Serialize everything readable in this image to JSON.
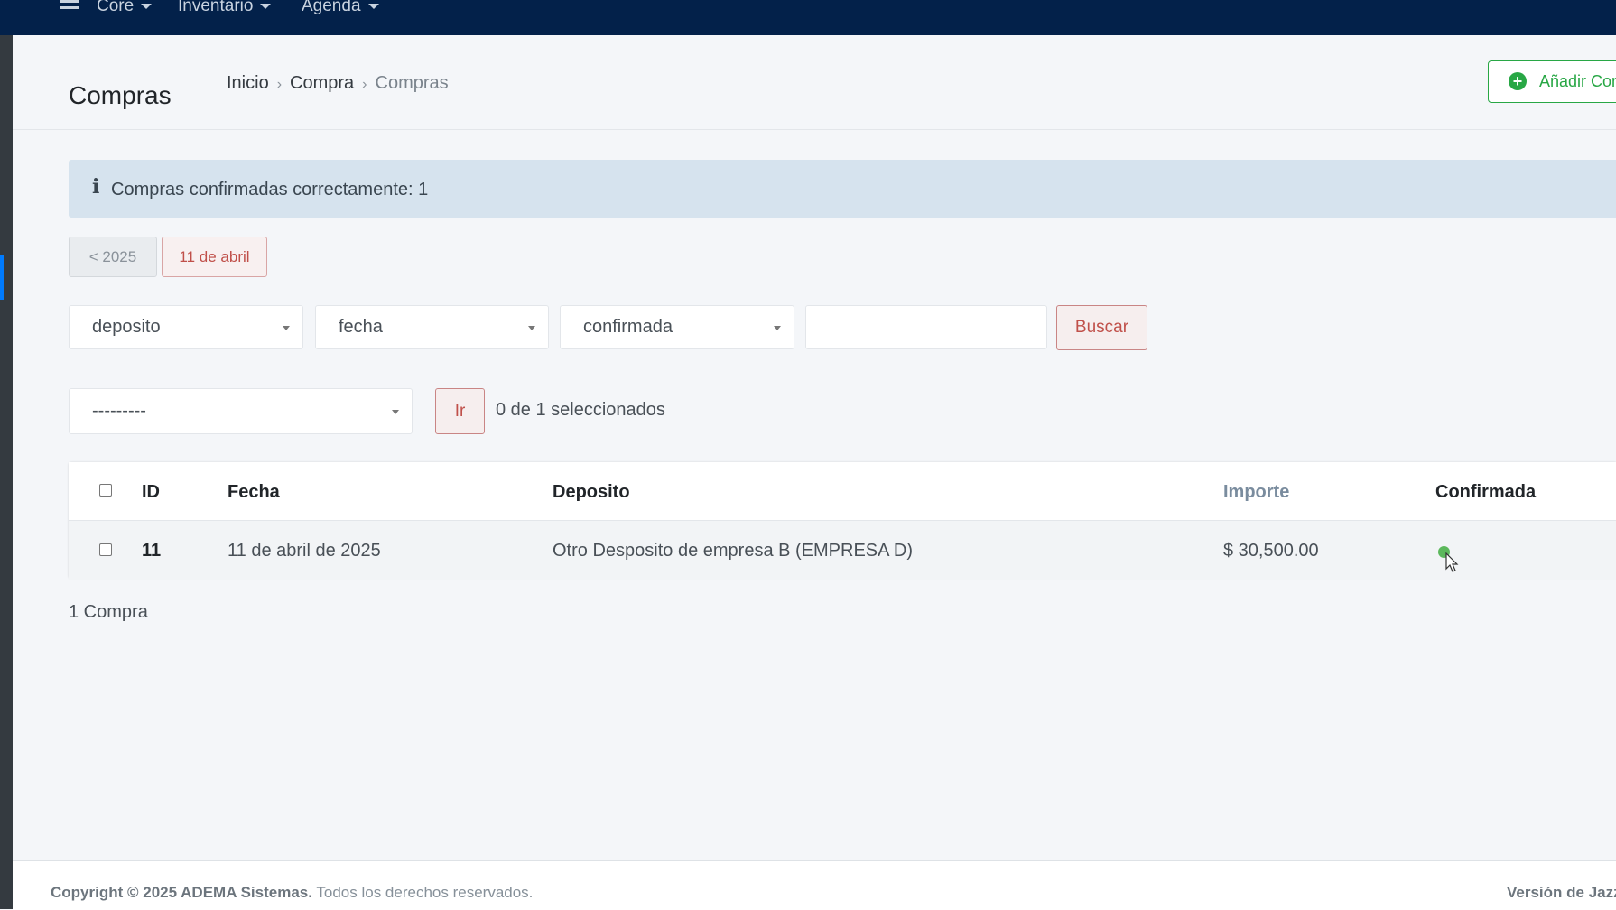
{
  "navbar": {
    "items": [
      {
        "label": "Core"
      },
      {
        "label": "Inventario"
      },
      {
        "label": "Agenda"
      }
    ]
  },
  "header": {
    "title": "Compras",
    "breadcrumb": [
      "Inicio",
      "Compra",
      "Compras"
    ],
    "add_button_label": "Añadir Compra"
  },
  "alert": {
    "icon": "info-icon",
    "message": "Compras confirmadas correctamente: 1"
  },
  "date_nav": {
    "prev_label": "< 2025",
    "current_label": "11 de abril"
  },
  "filters": {
    "deposito_selected": "deposito",
    "fecha_selected": "fecha",
    "confirmada_selected": "confirmada",
    "search_value": "",
    "search_button": "Buscar"
  },
  "actions": {
    "action_selected": "---------",
    "go_button": "Ir",
    "selected_count": "0 de 1 seleccionados"
  },
  "table": {
    "columns": [
      "ID",
      "Fecha",
      "Deposito",
      "Importe",
      "Confirmada"
    ],
    "rows": [
      {
        "id": "11",
        "fecha": "11 de abril de 2025",
        "deposito": "Otro Desposito de empresa B (EMPRESA D)",
        "importe": "$ 30,500.00",
        "confirmada_icon": "check-circle-icon",
        "confirmada_color": "#5cb85c"
      }
    ]
  },
  "summary": "1 Compra",
  "footer": {
    "copyright_brand": "Copyright © 2025 ADEMA Sistemas.",
    "copyright_rights": "Todos los derechos reservados.",
    "version_text": "Versión de Jazzmin"
  },
  "colors": {
    "navbar": "#03214a",
    "success": "#28a745",
    "danger_outline": "#c0504a",
    "alert_bg": "#d6e3ee"
  }
}
